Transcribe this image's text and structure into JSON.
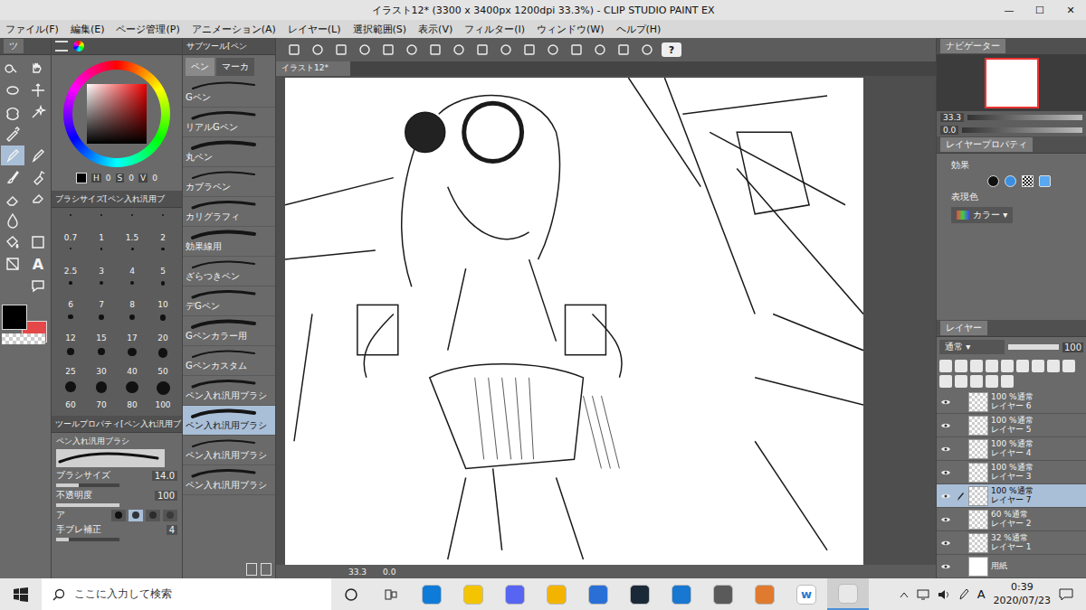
{
  "window": {
    "title": "イラスト12* (3300 x 3400px 1200dpi 33.3%) - CLIP STUDIO PAINT EX",
    "controls": [
      "—",
      "☐",
      "✕"
    ]
  },
  "menu": [
    "ファイル(F)",
    "編集(E)",
    "ページ管理(P)",
    "アニメーション(A)",
    "レイヤー(L)",
    "選択範囲(S)",
    "表示(V)",
    "フィルター(I)",
    "ウィンドウ(W)",
    "ヘルプ(H)"
  ],
  "tool_palette": {
    "tab": "ツ",
    "tools": [
      {
        "selected": false
      },
      {
        "selected": false
      },
      {
        "selected": false
      },
      {
        "selected": false
      },
      {
        "selected": false
      },
      {
        "selected": false
      },
      {
        "selected": false
      },
      {
        "selected": false
      },
      {
        "selected": true
      },
      {
        "selected": false
      },
      {
        "selected": false
      },
      {
        "selected": false
      },
      {
        "selected": false
      },
      {
        "selected": false
      },
      {
        "selected": false
      },
      {
        "selected": false
      },
      {
        "selected": false
      },
      {
        "selected": false
      },
      {
        "selected": false
      },
      {
        "selected": false,
        "glyph": "A"
      },
      {
        "selected": false
      },
      {
        "selected": false
      }
    ],
    "main_color": "#000000",
    "sub_color": "#e54848"
  },
  "color_panel": {
    "hsv": [
      {
        "label": "H",
        "value": "0"
      },
      {
        "label": "S",
        "value": "0"
      },
      {
        "label": "V",
        "value": "0"
      }
    ]
  },
  "brush_size": {
    "header": "ブラシサイズ[ペン入れ汎用ブ",
    "sizes": [
      "0.7",
      "1",
      "1.5",
      "2",
      "2.5",
      "3",
      "4",
      "5",
      "6",
      "7",
      "8",
      "10",
      "12",
      "15",
      "17",
      "20",
      "25",
      "30",
      "40",
      "50",
      "60",
      "70",
      "80",
      "100"
    ]
  },
  "tool_property": {
    "header": "ツールプロパティ[ペン入れ汎用ブ",
    "name": "ペン入れ汎用ブラシ",
    "sliders": [
      {
        "label": "ブラシサイズ",
        "value": "14.0",
        "level": 0.35
      },
      {
        "label": "不透明度",
        "value": "100",
        "level": 1.0
      }
    ],
    "antialias": {
      "label": "ア",
      "options": [
        {
          "selected": false
        },
        {
          "selected": true
        },
        {
          "selected": false
        },
        {
          "selected": false
        }
      ]
    },
    "stabilizer": {
      "label": "手ブレ補正",
      "value": "4",
      "level": 0.2
    }
  },
  "sub_tool": {
    "header": "サブツール[ペン",
    "tabs": [
      {
        "label": "ペン",
        "selected": true
      },
      {
        "label": "マーカ",
        "selected": false
      }
    ],
    "brushes": [
      {
        "label": "Gペン",
        "selected": false
      },
      {
        "label": "リアルGペン",
        "selected": false
      },
      {
        "label": "丸ペン",
        "selected": false
      },
      {
        "label": "カブラペン",
        "selected": false
      },
      {
        "label": "カリグラフィ",
        "selected": false
      },
      {
        "label": "効果線用",
        "selected": false
      },
      {
        "label": "ざらつきペン",
        "selected": false
      },
      {
        "label": "デGペン",
        "selected": false
      },
      {
        "label": "Gペンカラー用",
        "selected": false
      },
      {
        "label": "Gペンカスタム",
        "selected": false
      },
      {
        "label": "ペン入れ汎用ブラシ",
        "selected": false
      },
      {
        "label": "ペン入れ汎用ブラシ",
        "selected": true
      },
      {
        "label": "ペン入れ汎用ブラシ",
        "selected": false
      },
      {
        "label": "ペン入れ汎用ブラシ",
        "selected": false
      }
    ]
  },
  "command_bar": {
    "help": "?"
  },
  "canvas": {
    "tab": "イラスト12*",
    "zoom": "33.3",
    "angle": "0.0"
  },
  "navigator": {
    "tab": "ナビゲーター",
    "zoom": "33.3",
    "angle": "0.0"
  },
  "layer_property": {
    "tab": "レイヤープロパティ",
    "effect_label": "効果",
    "color_label": "表現色",
    "color_value": "カラー"
  },
  "layers": {
    "tab": "レイヤー",
    "blend": "通常",
    "opacity": "100",
    "items": [
      {
        "mode": "100 %通常",
        "name": "レイヤー 6",
        "visible": true,
        "selected": false,
        "kind": "raster"
      },
      {
        "mode": "100 %通常",
        "name": "レイヤー 5",
        "visible": true,
        "selected": false,
        "kind": "raster"
      },
      {
        "mode": "100 %通常",
        "name": "レイヤー 4",
        "visible": true,
        "selected": false,
        "kind": "raster"
      },
      {
        "mode": "100 %通常",
        "name": "レイヤー 3",
        "visible": true,
        "selected": false,
        "kind": "raster"
      },
      {
        "mode": "100 %通常",
        "name": "レイヤー 7",
        "visible": true,
        "selected": true,
        "kind": "raster"
      },
      {
        "mode": "60 %通常",
        "name": "レイヤー 2",
        "visible": true,
        "selected": false,
        "kind": "raster"
      },
      {
        "mode": "32 %通常",
        "name": "レイヤー 1",
        "visible": true,
        "selected": false,
        "kind": "raster"
      },
      {
        "mode": "",
        "name": "用紙",
        "visible": true,
        "selected": false,
        "kind": "paper"
      }
    ]
  },
  "taskbar": {
    "search_placeholder": "ここに入力して検索",
    "apps": [
      {
        "selected": false
      },
      {
        "selected": false
      },
      {
        "selected": false
      },
      {
        "selected": false
      },
      {
        "selected": false
      },
      {
        "selected": false
      },
      {
        "selected": false
      },
      {
        "selected": false
      },
      {
        "selected": false
      },
      {
        "selected": false,
        "glyph": "w"
      },
      {
        "selected": true
      }
    ],
    "ime": "A",
    "time": "0:39",
    "date": "2020/07/23"
  }
}
